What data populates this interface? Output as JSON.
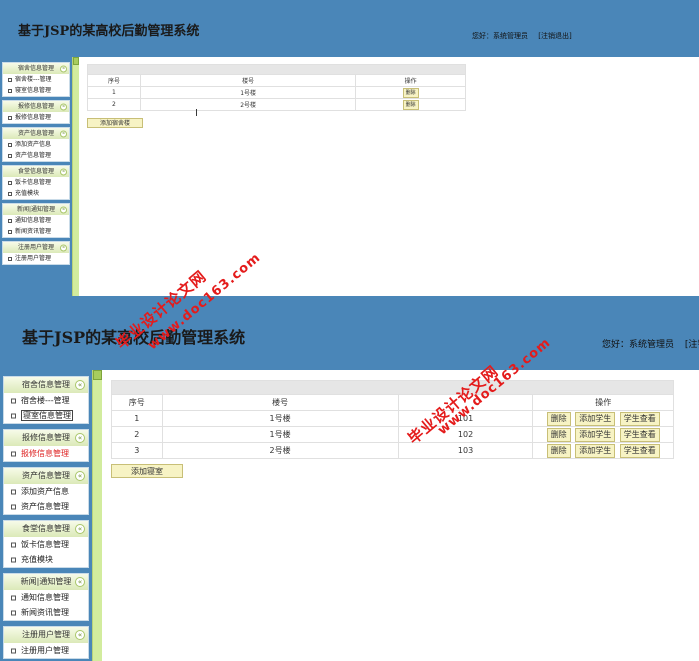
{
  "app_title": "基于JSP的某高校后勤管理系统",
  "greeting": "您好：系统管理员",
  "greeting_short": "您好：系统管理员",
  "logout": "[注销退出]",
  "logout_short": "[注销",
  "sidebar": [
    {
      "title": "宿舍信息管理",
      "items": [
        "宿舍楼---管理",
        "寝室信息管理"
      ]
    },
    {
      "title": "报修信息管理",
      "items": [
        "报修信息管理"
      ]
    },
    {
      "title": "资产信息管理",
      "items": [
        "添加资产信息",
        "资产信息管理"
      ]
    },
    {
      "title": "食堂信息管理",
      "items": [
        "饭卡信息管理",
        "充值模块"
      ]
    },
    {
      "title": "新闻|通知管理",
      "items": [
        "通知信息管理",
        "新闻资讯管理"
      ]
    },
    {
      "title": "注册用户管理",
      "items": [
        "注册用户管理"
      ]
    }
  ],
  "top_panel": {
    "headers": [
      "序号",
      "楼号",
      "操作"
    ],
    "rows": [
      {
        "no": "1",
        "building": "1号楼",
        "action": "删除"
      },
      {
        "no": "2",
        "building": "2号楼",
        "action": "删除"
      }
    ],
    "add_button": "添加宿舍楼"
  },
  "bottom_panel": {
    "headers": [
      "序号",
      "楼号",
      "操作"
    ],
    "rows": [
      {
        "no": "1",
        "building": "1号楼",
        "room": "101"
      },
      {
        "no": "2",
        "building": "1号楼",
        "room": "102"
      },
      {
        "no": "3",
        "building": "2号楼",
        "room": "103"
      }
    ],
    "actions": [
      "删除",
      "添加学生",
      "学生查看"
    ],
    "add_button": "添加寝室"
  },
  "watermarks": {
    "cn": "毕业设计论文网",
    "url": "www.doc163.com"
  },
  "colors": {
    "header_blue": "#4a86b8",
    "watermark_red": "#e41b1b",
    "button_yellow": "#f7f3c4",
    "strip_green": "#d2ec9e"
  }
}
